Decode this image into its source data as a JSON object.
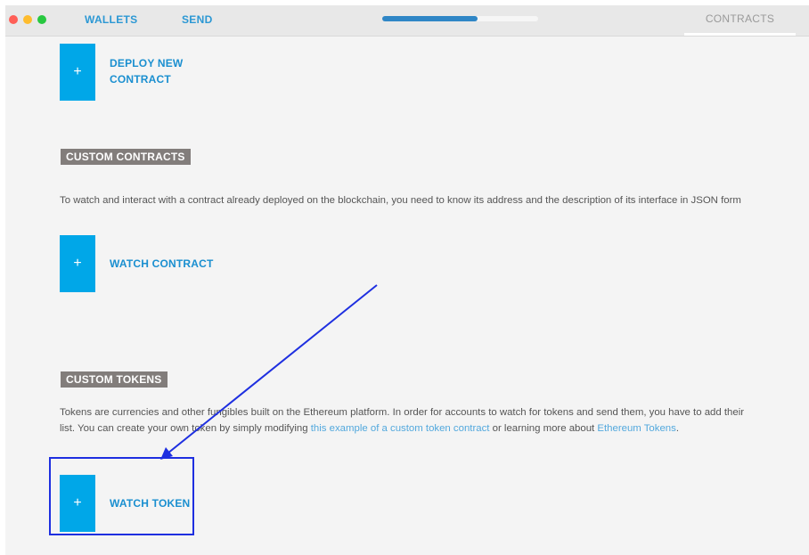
{
  "topbar": {
    "nav_wallets": "WALLETS",
    "nav_send": "SEND",
    "nav_contracts": "CONTRACTS",
    "sync_progress_percent": 61
  },
  "deploy": {
    "plus": "+",
    "label": "DEPLOY NEW CONTRACT"
  },
  "custom_contracts": {
    "heading": "CUSTOM CONTRACTS",
    "description": "To watch and interact with a contract already deployed on the blockchain, you need to know its address and the description of its interface in JSON form",
    "watch_plus": "+",
    "watch_label": "WATCH CONTRACT"
  },
  "custom_tokens": {
    "heading": "CUSTOM TOKENS",
    "description_line1": "Tokens are currencies and other fungibles built on the Ethereum platform. In order for accounts to watch for tokens and send them, you have to add their",
    "description_line2_start": "list. You can create your own token by simply modifying ",
    "link_example": "this example of a custom token contract",
    "description_mid": " or learning more about ",
    "link_tokens": "Ethereum Tokens",
    "description_end": ".",
    "watch_plus": "+",
    "watch_label": "WATCH TOKEN"
  },
  "colors": {
    "accent_blue": "#00a7e8",
    "link_blue": "#52a8dd",
    "annotation_blue": "#1e2fe0",
    "section_header_bg": "#827d7b"
  }
}
